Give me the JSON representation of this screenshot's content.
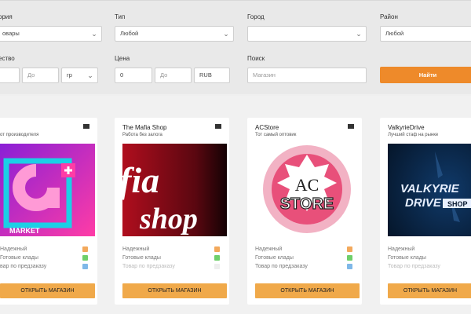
{
  "filters": {
    "category": {
      "label": "ория",
      "value": "овары"
    },
    "type": {
      "label": "Тип",
      "value": "Любой"
    },
    "city": {
      "label": "Город",
      "value": ""
    },
    "district": {
      "label": "Район",
      "value": "Любой"
    },
    "quantity": {
      "label": "ество",
      "to_placeholder": "До",
      "unit": "гр"
    },
    "price": {
      "label": "Цена",
      "from_value": "0",
      "to_placeholder": "До",
      "currency": "RUB"
    },
    "search": {
      "label": "Поиск",
      "placeholder": "Магазин"
    },
    "find_button": "Найти"
  },
  "shops": [
    {
      "name": "",
      "subtitle": "от производителя",
      "logo_text": "MARKET",
      "logo_colors": [
        "#8a1fd6",
        "#ff3ca6",
        "#1bd0e6"
      ],
      "features": [
        "Надежный",
        "Готовые клады",
        "вар по предзаказу"
      ],
      "open_label": "ОТКРЫТЬ МАГАЗИН"
    },
    {
      "name": "The Mafia Shop",
      "subtitle": "Работа без залога",
      "logo_text_1": "fia",
      "logo_text_2": "shop",
      "logo_colors": [
        "#b00e1e",
        "#140204",
        "#ffffff"
      ],
      "features": [
        "Надежный",
        "Готовые клады",
        "Товар по предзаказу"
      ],
      "open_label": "ОТКРЫТЬ МАГАЗИН"
    },
    {
      "name": "ACStore",
      "subtitle": "Тот самый оптовик",
      "logo_text_1": "AC",
      "logo_text_2": "STORE",
      "logo_colors": [
        "#f2b2c4",
        "#e8507a",
        "#222222"
      ],
      "features": [
        "Надежный",
        "Готовые клады",
        "Товар по предзаказу"
      ],
      "open_label": "ОТКРЫТЬ МАГАЗИН"
    },
    {
      "name": "ValkyrieDrive",
      "subtitle": "Лучший стаф на рынке",
      "logo_text_1": "VALKYRIE",
      "logo_text_2": "DRIVE",
      "logo_text_3": "SHOP",
      "logo_colors": [
        "#06182e",
        "#103a6a",
        "#e8f0ff"
      ],
      "features": [
        "Надежный",
        "Готовые клады",
        "Товар по предзаказу"
      ],
      "open_label": "ОТКРЫТЬ МАГАЗИН"
    }
  ],
  "feature_colors": {
    "reliable": "#f3a95c",
    "ready": "#6fcf6a",
    "preorder": "#7fb8e8"
  }
}
